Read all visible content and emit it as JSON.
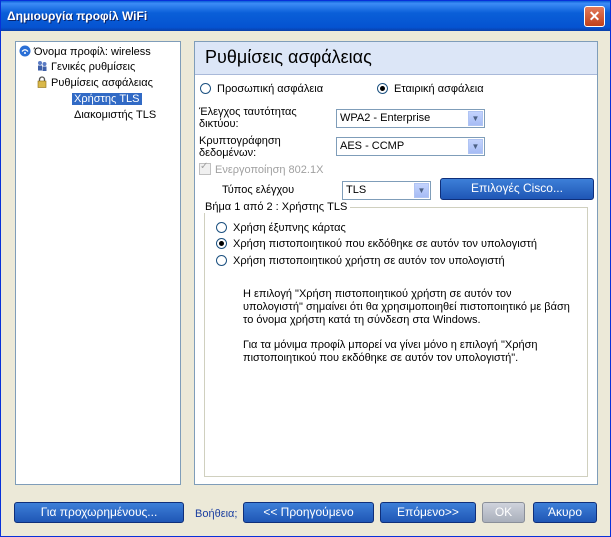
{
  "window": {
    "title": "Δημιουργία προφίλ WiFi",
    "close": "✕"
  },
  "tree": {
    "items": [
      {
        "label": "Όνομα προφίλ: wireless"
      },
      {
        "label": "Γενικές ρυθμίσεις"
      },
      {
        "label": "Ρυθμίσεις ασφάλειας"
      },
      {
        "label": "Χρήστης TLS"
      },
      {
        "label": "Διακομιστής TLS"
      }
    ]
  },
  "panel": {
    "heading": "Ρυθμίσεις ασφάλειας",
    "personal_label": "Προσωπική ασφάλεια",
    "enterprise_label": "Εταιρική ασφάλεια",
    "auth_label": "Έλεγχος ταυτότητας δικτύου:",
    "auth_value": "WPA2 - Enterprise",
    "encryption_label": "Κρυπτογράφηση δεδομένων:",
    "encryption_value": "AES - CCMP",
    "enable_8021x_label": "Ενεργοποίηση 802.1X",
    "auth_type_label": "Τύπος ελέγχου",
    "auth_type_value": "TLS",
    "cisco_button": "Επιλογές Cisco..."
  },
  "step": {
    "title": "Βήμα 1 από 2 : Χρήστης TLS",
    "options": [
      "Χρήση έξυπνης κάρτας",
      "Χρήση πιστοποιητικού που εκδόθηκε σε αυτόν τον υπολογιστή",
      "Χρήση πιστοποιητικού χρήστη σε αυτόν τον υπολογιστή"
    ],
    "info1": "Η επιλογή \"Χρήση πιστοποιητικού χρήστη σε αυτόν τον υπολογιστή\" σημαίνει ότι θα χρησιμοποιηθεί πιστοποιητικό με βάση το όνομα χρήστη κατά τη σύνδεση στα Windows.",
    "info2": "Για τα μόνιμα προφίλ μπορεί να γίνει μόνο η επιλογή \"Χρήση πιστοποιητικού που εκδόθηκε σε αυτόν τον υπολογιστή\"."
  },
  "footer": {
    "advanced": "Για προχωρημένους...",
    "help": "Βοήθεια;",
    "back": "<< Προηγούμενο",
    "next": "Επόμενο>>",
    "ok": "OK",
    "cancel": "Άκυρο"
  }
}
